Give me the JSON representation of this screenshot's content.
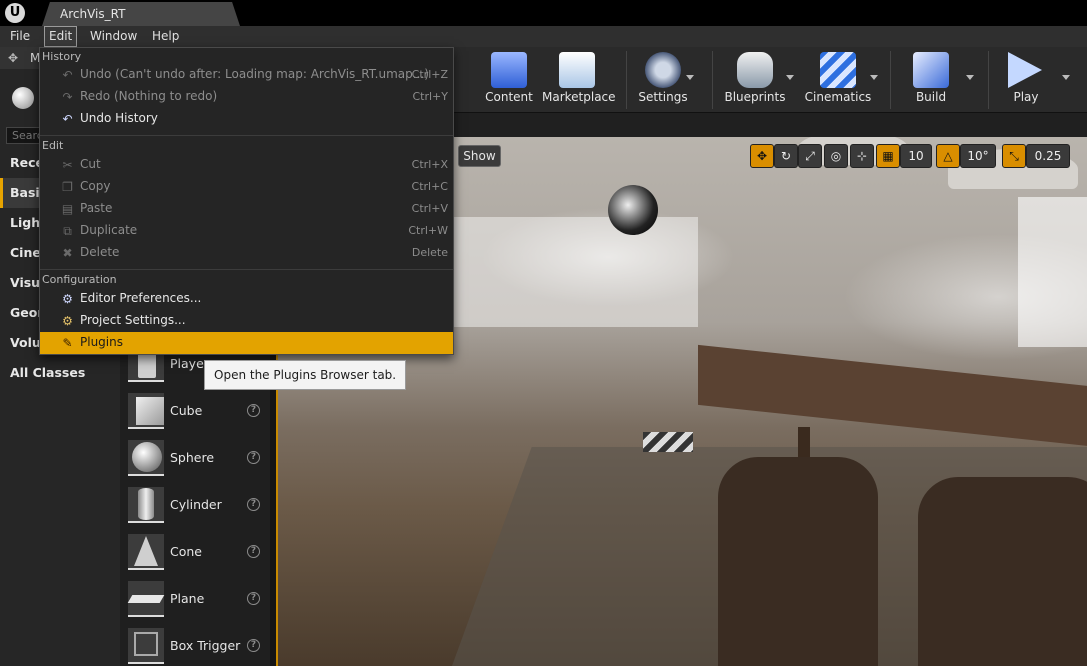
{
  "window": {
    "logo": "U",
    "document_tab": "ArchVis_RT"
  },
  "menubar": {
    "file": "File",
    "edit": "Edit",
    "window": "Window",
    "help": "Help"
  },
  "modes_panel": {
    "tab_label": "M",
    "search_placeholder": "Searc",
    "categories": [
      "Rece",
      "Basic",
      "Light",
      "Cine",
      "Visua",
      "Geom",
      "Volur",
      "All Classes"
    ],
    "selected_category": "Basic"
  },
  "place_items": [
    {
      "label": "Player",
      "icon": "player-start-icon"
    },
    {
      "label": "Cube",
      "icon": "cube-icon"
    },
    {
      "label": "Sphere",
      "icon": "sphere-icon"
    },
    {
      "label": "Cylinder",
      "icon": "cylinder-icon"
    },
    {
      "label": "Cone",
      "icon": "cone-icon"
    },
    {
      "label": "Plane",
      "icon": "plane-icon"
    },
    {
      "label": "Box Trigger",
      "icon": "box-trigger-icon"
    }
  ],
  "toolbar": {
    "content": "Content",
    "marketplace": "Marketplace",
    "settings": "Settings",
    "blueprints": "Blueprints",
    "cinematics": "Cinematics",
    "build": "Build",
    "play": "Play"
  },
  "viewport": {
    "show": "Show",
    "grid_snap": "10",
    "rotation_snap": "10°",
    "scale_snap": "0.25"
  },
  "edit_menu": {
    "history_header": "History",
    "undo": {
      "label": "Undo (Can't undo after: Loading map: ArchVis_RT.umap...)",
      "shortcut": "Ctrl+Z"
    },
    "redo": {
      "label": "Redo (Nothing to redo)",
      "shortcut": "Ctrl+Y"
    },
    "undo_history": {
      "label": "Undo History"
    },
    "edit_header": "Edit",
    "cut": {
      "label": "Cut",
      "shortcut": "Ctrl+X"
    },
    "copy": {
      "label": "Copy",
      "shortcut": "Ctrl+C"
    },
    "paste": {
      "label": "Paste",
      "shortcut": "Ctrl+V"
    },
    "duplicate": {
      "label": "Duplicate",
      "shortcut": "Ctrl+W"
    },
    "delete": {
      "label": "Delete",
      "shortcut": "Delete"
    },
    "config_header": "Configuration",
    "editor_prefs": {
      "label": "Editor Preferences..."
    },
    "project_settings": {
      "label": "Project Settings..."
    },
    "plugins": {
      "label": "Plugins"
    }
  },
  "tooltip": "Open the Plugins Browser tab.",
  "colors": {
    "accent": "#e3a300",
    "menu_bg": "#252525",
    "viewport_border": "#c88a00"
  }
}
